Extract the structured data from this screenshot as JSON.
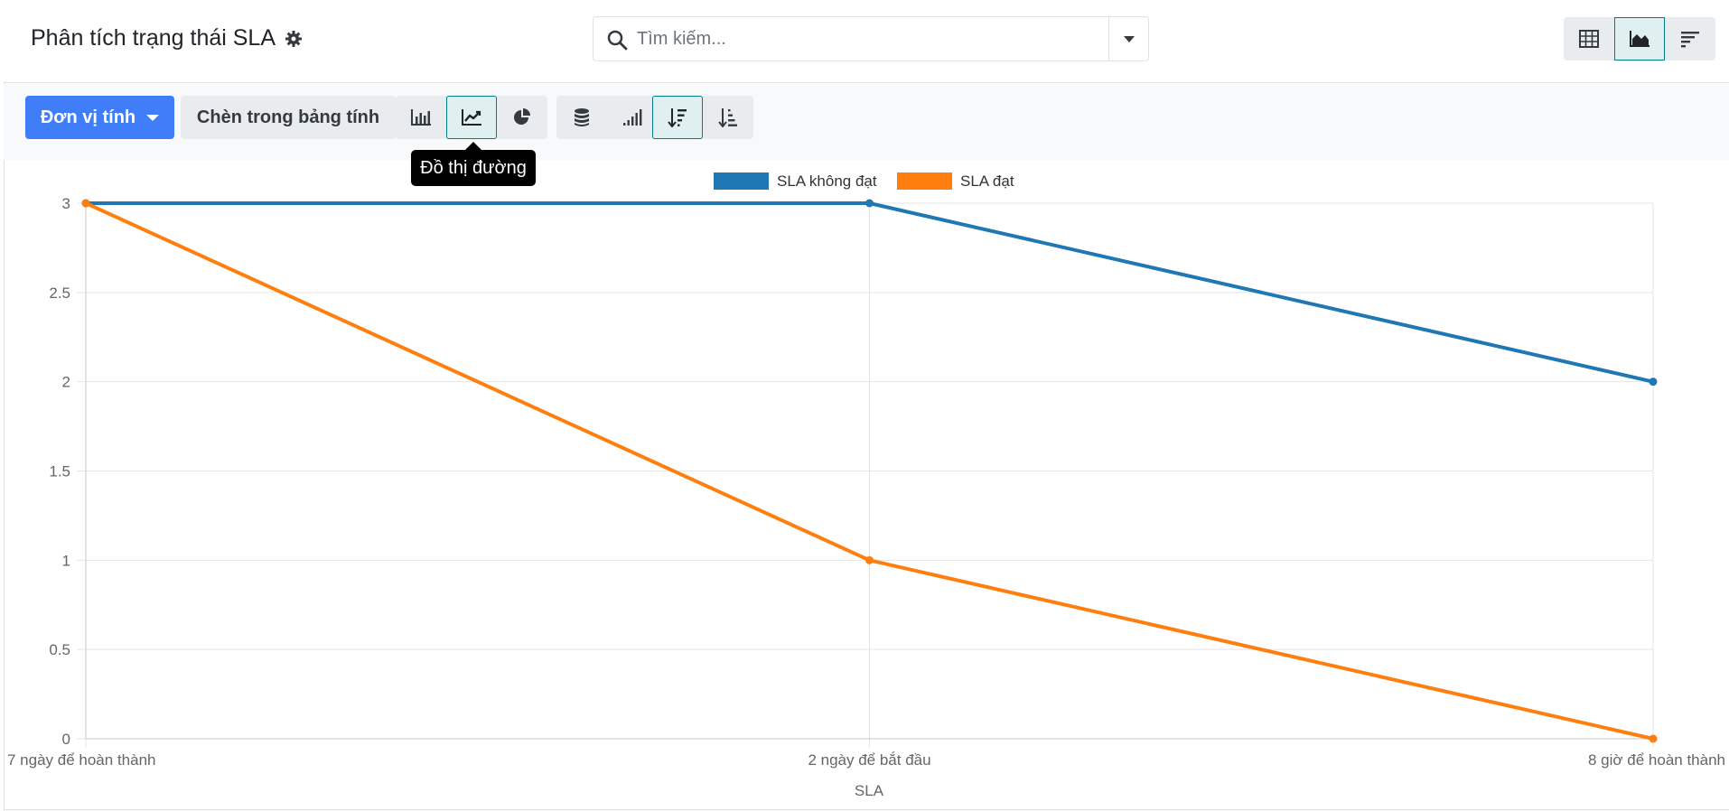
{
  "header": {
    "title": "Phân tích trạng thái SLA",
    "search_placeholder": "Tìm kiếm..."
  },
  "view_switcher": [
    "table-view",
    "graph-view",
    "list-view"
  ],
  "toolbar": {
    "measure_label": "Đơn vị tính",
    "insert_label": "Chèn trong bảng tính",
    "tooltip": "Đồ thị đường"
  },
  "colors": {
    "primary": "#3f7ef8",
    "active_border": "#017e84",
    "series_1": "#1f77b4",
    "series_2": "#ff7f0e"
  },
  "chart_data": {
    "type": "line",
    "categories": [
      "7 ngày để hoàn thành",
      "2 ngày để bắt đầu",
      "8 giờ để hoàn thành"
    ],
    "series": [
      {
        "name": "SLA không đạt",
        "color": "#1f77b4",
        "values": [
          3,
          3,
          2
        ]
      },
      {
        "name": "SLA đạt",
        "color": "#ff7f0e",
        "values": [
          3,
          1,
          0
        ]
      }
    ],
    "xlabel": "SLA",
    "ylabel": "",
    "ylim": [
      0,
      3
    ],
    "yticks": [
      "0",
      "0.5",
      "1",
      "1.5",
      "2",
      "2.5",
      "3"
    ],
    "legend": "top-center",
    "grid": true
  }
}
